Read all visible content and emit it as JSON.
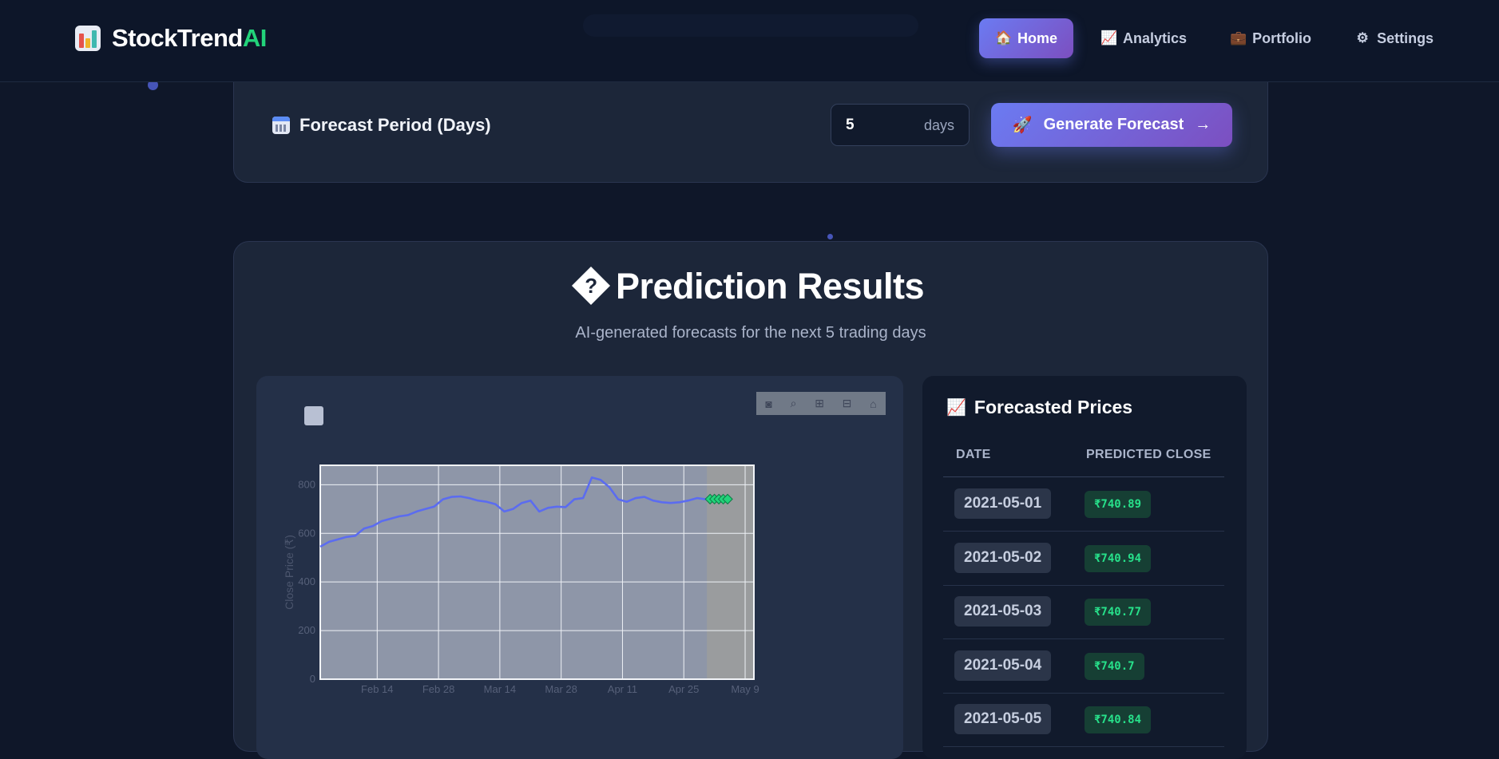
{
  "app": {
    "brand_main": "StockTrend",
    "brand_accent": "AI"
  },
  "nav": [
    {
      "label": "Home",
      "icon": "🏠",
      "icon_name": "home-icon",
      "active": true
    },
    {
      "label": "Analytics",
      "icon": "📈",
      "icon_name": "chart-increasing-icon",
      "active": false
    },
    {
      "label": "Portfolio",
      "icon": "💼",
      "icon_name": "briefcase-icon",
      "active": false
    },
    {
      "label": "Settings",
      "icon": "⚙",
      "icon_name": "gear-icon",
      "active": false
    }
  ],
  "forecast": {
    "label": "Forecast Period (Days)",
    "value": "5",
    "unit": "days",
    "button_label": "Generate Forecast",
    "button_icon": "🚀",
    "button_arrow": "→"
  },
  "results": {
    "title": "Prediction Results",
    "subtitle": "AI-generated forecasts for the next 5 trading days"
  },
  "table": {
    "title": "Forecasted Prices",
    "col_date": "DATE",
    "col_price": "PREDICTED CLOSE",
    "rows": [
      {
        "date": "2021-05-01",
        "price": "₹740.89"
      },
      {
        "date": "2021-05-02",
        "price": "₹740.94"
      },
      {
        "date": "2021-05-03",
        "price": "₹740.77"
      },
      {
        "date": "2021-05-04",
        "price": "₹740.7"
      },
      {
        "date": "2021-05-05",
        "price": "₹740.84"
      }
    ]
  },
  "chart_data": {
    "type": "line",
    "ylabel": "Close Price (₹)",
    "ylim": [
      0,
      880
    ],
    "y_ticks": [
      0,
      200,
      400,
      600,
      800
    ],
    "x_ticks": [
      "Feb 14",
      "Feb 28",
      "Mar 14",
      "Mar 28",
      "Apr 11",
      "Apr 25",
      "May 9"
    ],
    "x_range": [
      "2021-02-01",
      "2021-05-11"
    ],
    "series": [
      {
        "kind": "historical",
        "color": "#5b6cf0",
        "x": [
          "2021-02-01",
          "2021-02-03",
          "2021-02-05",
          "2021-02-07",
          "2021-02-09",
          "2021-02-11",
          "2021-02-13",
          "2021-02-15",
          "2021-02-17",
          "2021-02-19",
          "2021-02-21",
          "2021-02-23",
          "2021-02-25",
          "2021-02-27",
          "2021-03-01",
          "2021-03-03",
          "2021-03-05",
          "2021-03-07",
          "2021-03-09",
          "2021-03-11",
          "2021-03-13",
          "2021-03-15",
          "2021-03-17",
          "2021-03-19",
          "2021-03-21",
          "2021-03-23",
          "2021-03-25",
          "2021-03-27",
          "2021-03-29",
          "2021-03-31",
          "2021-04-02",
          "2021-04-04",
          "2021-04-06",
          "2021-04-08",
          "2021-04-10",
          "2021-04-12",
          "2021-04-14",
          "2021-04-16",
          "2021-04-18",
          "2021-04-20",
          "2021-04-22",
          "2021-04-24",
          "2021-04-26",
          "2021-04-28",
          "2021-04-30"
        ],
        "y": [
          545,
          565,
          575,
          585,
          590,
          620,
          630,
          650,
          660,
          670,
          675,
          690,
          700,
          710,
          740,
          750,
          752,
          745,
          735,
          730,
          720,
          690,
          700,
          725,
          735,
          690,
          705,
          710,
          708,
          740,
          745,
          830,
          820,
          790,
          740,
          730,
          745,
          750,
          735,
          728,
          725,
          728,
          735,
          745,
          740
        ]
      },
      {
        "kind": "forecast",
        "color": "#22d37a",
        "x": [
          "2021-05-01",
          "2021-05-02",
          "2021-05-03",
          "2021-05-04",
          "2021-05-05"
        ],
        "y": [
          740.89,
          740.94,
          740.77,
          740.7,
          740.84
        ]
      }
    ]
  }
}
